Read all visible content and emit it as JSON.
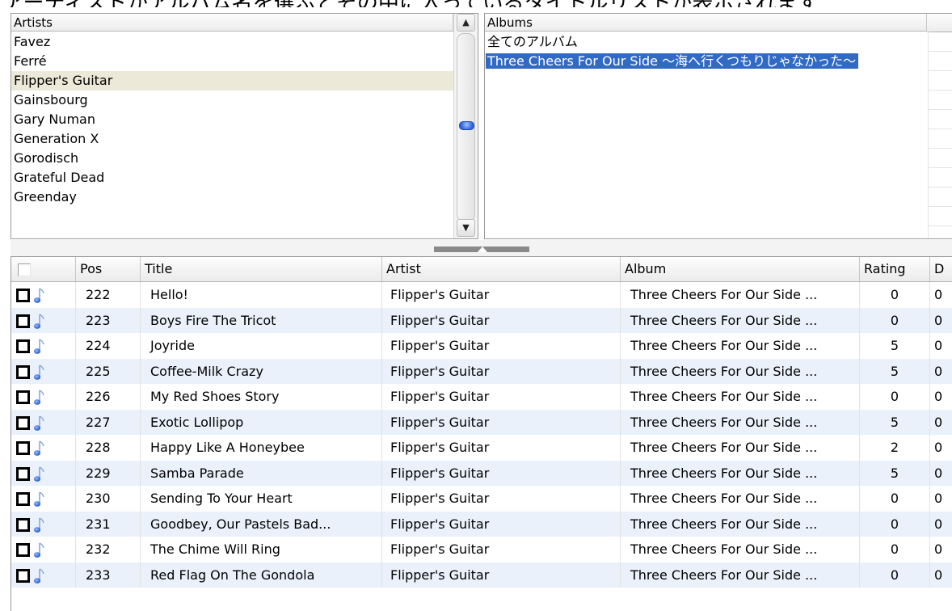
{
  "caption": "アーティストかアルバム名を選ぶとその中に入っているタイトルリストが表示されます",
  "artists_pane": {
    "header": "Artists",
    "items": [
      "Favez",
      "Ferré",
      "Flipper's Guitar",
      "Gainsbourg",
      "Gary Numan",
      "Generation X",
      "Gorodisch",
      "Grateful Dead",
      "Greenday"
    ],
    "selected": "Flipper's Guitar",
    "scroll_up_icon": "arrow-up-icon",
    "scroll_down_icon": "arrow-down-icon"
  },
  "albums_pane": {
    "header": "Albums",
    "items": [
      "全てのアルバム",
      "Three Cheers For Our Side ～海へ行くつもりじゃなかった～"
    ],
    "selected": "Three Cheers For Our Side ～海へ行くつもりじゃなかった～"
  },
  "tracks": {
    "columns": {
      "pos": "Pos",
      "title": "Title",
      "artist": "Artist",
      "album": "Album",
      "rating": "Rating",
      "extra": "D"
    },
    "rows": [
      {
        "pos": "222",
        "title": "Hello!",
        "artist": "Flipper's Guitar",
        "album": "Three Cheers For Our Side ...",
        "rating": "0",
        "extra": "0"
      },
      {
        "pos": "223",
        "title": "Boys Fire The Tricot",
        "artist": "Flipper's Guitar",
        "album": "Three Cheers For Our Side ...",
        "rating": "0",
        "extra": "0"
      },
      {
        "pos": "224",
        "title": "Joyride",
        "artist": "Flipper's Guitar",
        "album": "Three Cheers For Our Side ...",
        "rating": "5",
        "extra": "0"
      },
      {
        "pos": "225",
        "title": "Coffee-Milk Crazy",
        "artist": "Flipper's Guitar",
        "album": "Three Cheers For Our Side ...",
        "rating": "5",
        "extra": "0"
      },
      {
        "pos": "226",
        "title": "My Red Shoes Story",
        "artist": "Flipper's Guitar",
        "album": "Three Cheers For Our Side ...",
        "rating": "0",
        "extra": "0"
      },
      {
        "pos": "227",
        "title": "Exotic Lollipop",
        "artist": "Flipper's Guitar",
        "album": "Three Cheers For Our Side ...",
        "rating": "5",
        "extra": "0"
      },
      {
        "pos": "228",
        "title": "Happy Like A Honeybee",
        "artist": "Flipper's Guitar",
        "album": "Three Cheers For Our Side ...",
        "rating": "2",
        "extra": "0"
      },
      {
        "pos": "229",
        "title": "Samba Parade",
        "artist": "Flipper's Guitar",
        "album": "Three Cheers For Our Side ...",
        "rating": "5",
        "extra": "0"
      },
      {
        "pos": "230",
        "title": "Sending To Your Heart",
        "artist": "Flipper's Guitar",
        "album": "Three Cheers For Our Side ...",
        "rating": "0",
        "extra": "0"
      },
      {
        "pos": "231",
        "title": "Goodbey, Our Pastels Bad...",
        "artist": "Flipper's Guitar",
        "album": "Three Cheers For Our Side ...",
        "rating": "0",
        "extra": "0"
      },
      {
        "pos": "232",
        "title": "The Chime Will Ring",
        "artist": "Flipper's Guitar",
        "album": "Three Cheers For Our Side ...",
        "rating": "0",
        "extra": "0"
      },
      {
        "pos": "233",
        "title": "Red Flag On The Gondola",
        "artist": "Flipper's Guitar",
        "album": "Three Cheers For Our Side ...",
        "rating": "0",
        "extra": "0"
      }
    ],
    "row_icon": "music-note-icon"
  },
  "colors": {
    "selection": "#316ac5",
    "selected_artist_bg": "#ece9d8",
    "alt_row": "#eaf1fb",
    "note_icon": "#3a6fd8"
  }
}
